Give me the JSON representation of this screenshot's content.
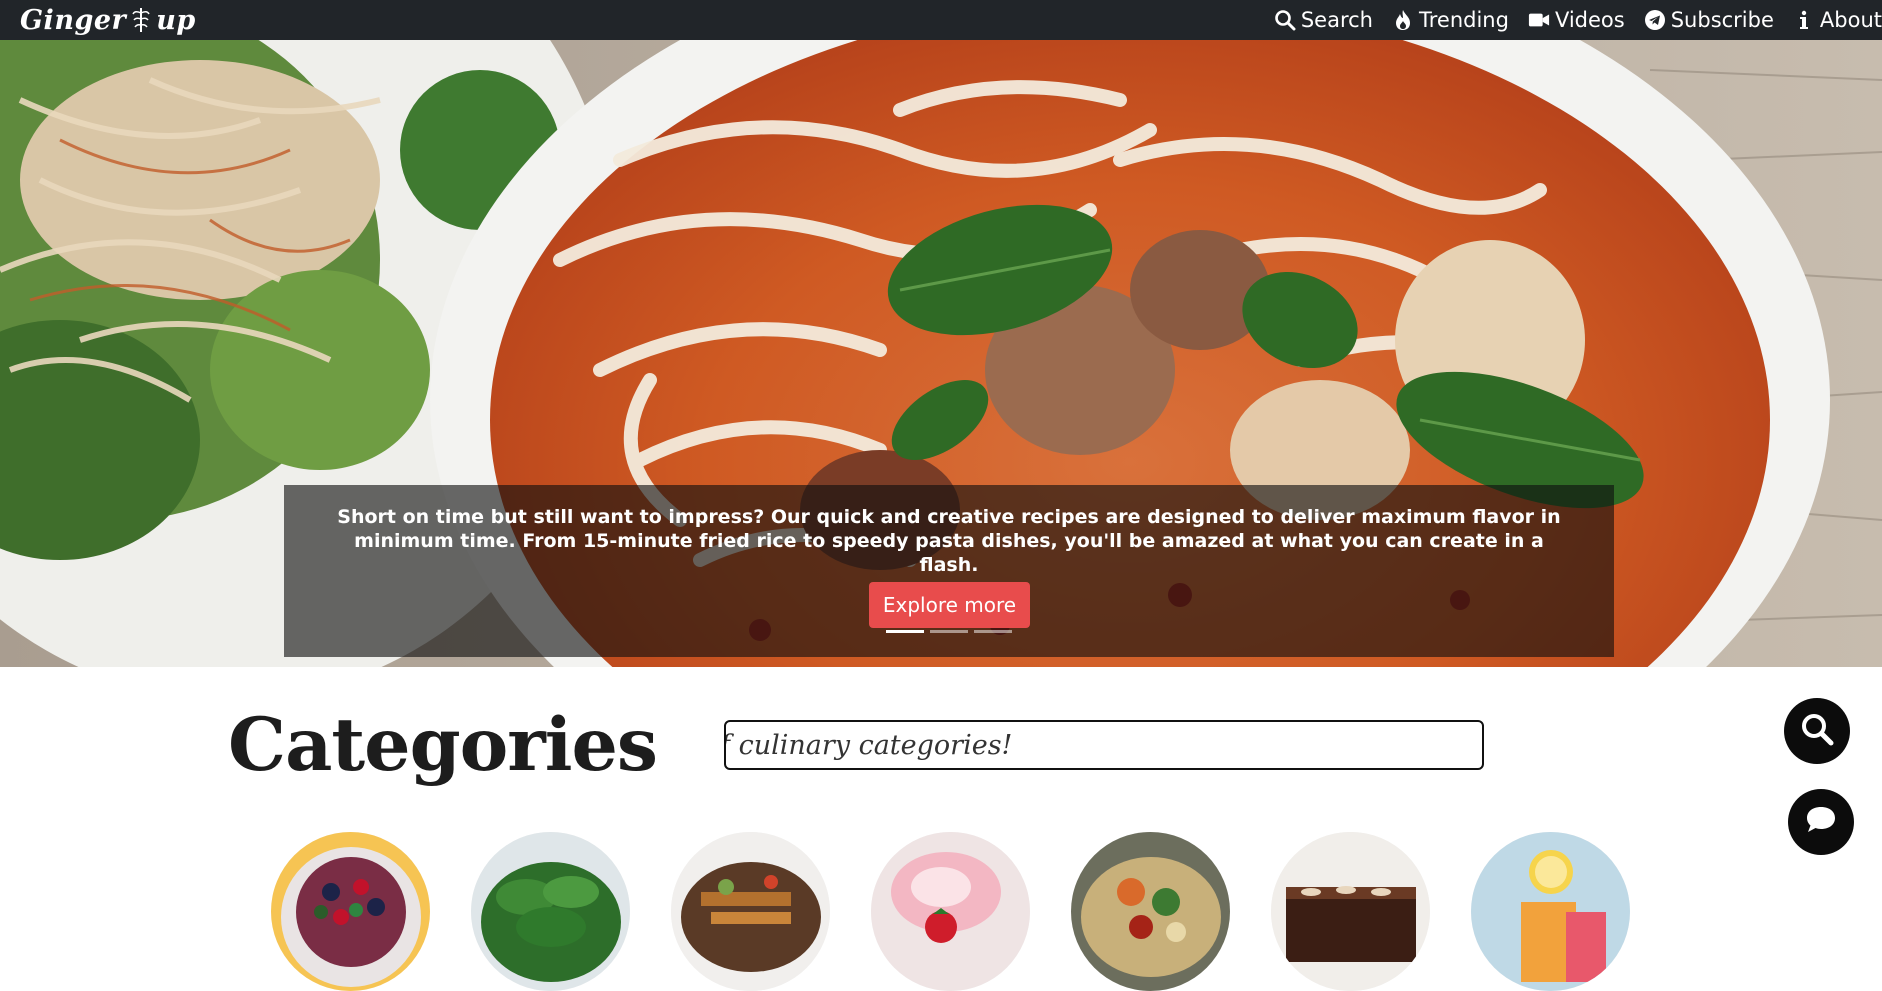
{
  "navbar": {
    "logo_text_left": "Ginger",
    "logo_text_right": "up",
    "links": [
      {
        "label": "Search",
        "icon": "search-icon"
      },
      {
        "label": "Trending",
        "icon": "fire-icon"
      },
      {
        "label": "Videos",
        "icon": "video-camera-icon"
      },
      {
        "label": "Subscribe",
        "icon": "telegram-icon"
      },
      {
        "label": "About",
        "icon": "info-icon"
      }
    ]
  },
  "hero": {
    "caption": "Short on time but still want to impress? Our quick and creative recipes are designed to deliver maximum flavor in minimum time. From 15-minute fried rice to speedy pasta dishes, you'll be amazed at what you can create in a flash.",
    "button_label": "Explore more",
    "slides_count": 3,
    "active_slide": 1
  },
  "categories": {
    "title": "Categories",
    "search_text": "f culinary categories!",
    "items": [
      "category-1",
      "category-2",
      "category-3",
      "category-4",
      "category-5",
      "category-6",
      "category-7"
    ]
  },
  "colors": {
    "navbar_bg": "#212529",
    "button_red": "#e84c4c",
    "fab_bg": "#0c0c0c"
  }
}
